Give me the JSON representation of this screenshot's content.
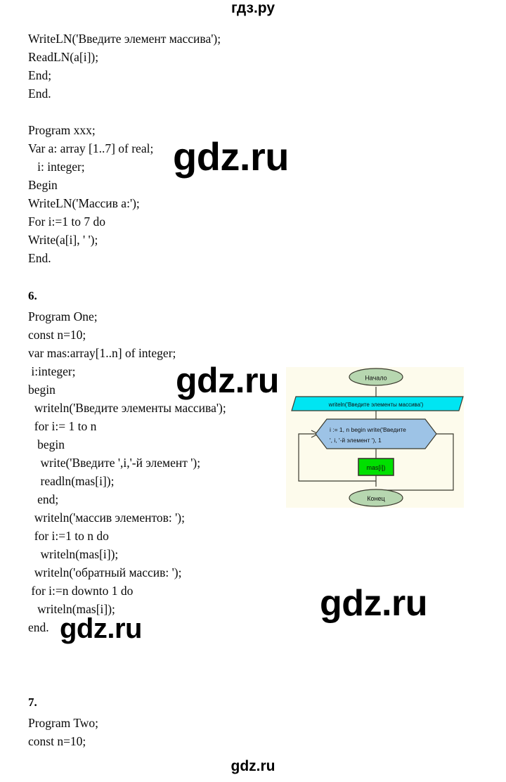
{
  "watermarks": {
    "header": "гдз.ру",
    "footer": "gdz.ru",
    "big_1": "gdz.ru",
    "big_2": "gdz.ru",
    "big_3": "gdz.ru",
    "big_4": "gdz.ru"
  },
  "page": {
    "code_block_1": "WriteLN('Введите элемент массива');\nReadLN(a[i]);\nEnd;\nEnd.",
    "code_block_2": "Program xxx;\nVar a: array [1..7] of real;\n   i: integer;\nBegin\nWriteLN('Массив a:');\nFor i:=1 to 7 do\nWrite(a[i], ' ');\nEnd.",
    "task_6_number": "6.",
    "code_block_3": "Program One;\nconst n=10;\nvar mas:array[1..n] of integer;\n i:integer;\nbegin\n  writeln('Введите элементы массива');\n  for i:= 1 to n\n   begin\n    write('Введите ',i,'-й элемент ');\n    readln(mas[i]);\n   end;\n  writeln('массив элементов: ');\n  for i:=1 to n do\n    writeln(mas[i]);\n  writeln('обратный массив: ');\n for i:=n downto 1 do\n   writeln(mas[i]);\nend.",
    "task_7_number": "7.",
    "code_block_4": "Program Two;\nconst n=10;"
  },
  "flowchart": {
    "start_label": "Начало",
    "output_label": "writeln('Введите элементы массива')",
    "loop_line_1": "i := 1, n begin write('Введите",
    "loop_line_2": "', i, '-й элемент '), 1",
    "process_label": "mas[i])",
    "end_label": "Конец",
    "colors": {
      "panel_background": "#fdfbec",
      "terminator_fill": "#b7d7b0",
      "io_fill": "#00e5f2",
      "loop_fill": "#9dc3e6",
      "process_fill": "#00e000",
      "outline": "#3a3a2e"
    }
  }
}
